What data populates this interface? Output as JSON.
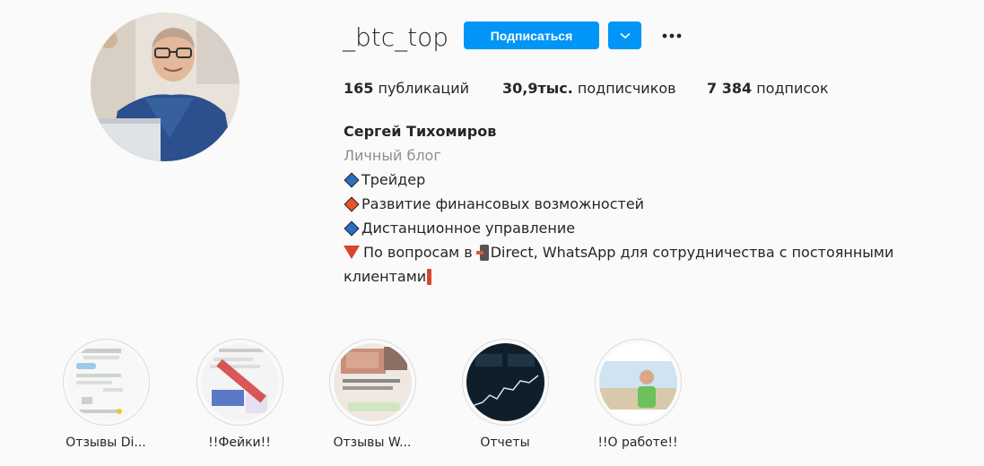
{
  "profile": {
    "username": "_btc_top",
    "follow_label": "Подписаться"
  },
  "stats": {
    "posts_count": "165",
    "posts_label": "публикаций",
    "followers_count": "30,9тыс.",
    "followers_label": "подписчиков",
    "following_count": "7 384",
    "following_label": "подписок"
  },
  "bio": {
    "full_name": "Сергей Тихомиров",
    "category": "Личный блог",
    "line1": "Трейдер",
    "line2": "Развитие финансовых возможностей",
    "line3": "Дистанционное управление",
    "line4a": "По вопросам в",
    "line4b": "Direct, WhatsApp для сотрудничества с постоянными",
    "line5": "клиентами"
  },
  "highlights": [
    {
      "label": "Отзывы Di..."
    },
    {
      "label": "!!Фейки!!"
    },
    {
      "label": "Отзывы W..."
    },
    {
      "label": "Отчеты"
    },
    {
      "label": "!!О работе!!"
    }
  ],
  "colors": {
    "accent": "#0095f6",
    "text": "#262626",
    "secondary": "#8e8e8e",
    "background": "#fafafa"
  }
}
